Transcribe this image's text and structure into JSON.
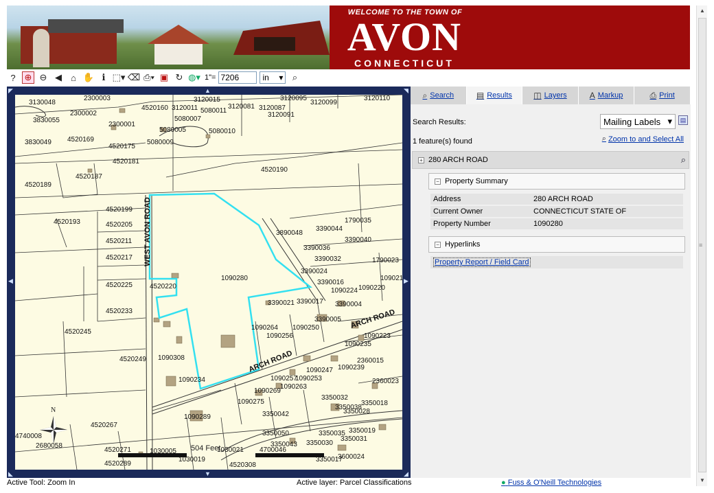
{
  "banner": {
    "welcome": "WELCOME TO THE TOWN OF",
    "town": "AVON",
    "state": "CONNECTICUT"
  },
  "toolbar": {
    "tools": [
      {
        "name": "help-icon",
        "glyph": "?"
      },
      {
        "name": "zoom-in-icon",
        "glyph": "⊕"
      },
      {
        "name": "zoom-out-icon",
        "glyph": "⊖"
      },
      {
        "name": "back-icon",
        "glyph": "◀"
      },
      {
        "name": "full-extent-icon",
        "glyph": "⌂"
      },
      {
        "name": "pan-hand-icon",
        "glyph": "✋"
      },
      {
        "name": "identify-icon",
        "glyph": "ℹ"
      },
      {
        "name": "select-icon",
        "glyph": "⬚"
      },
      {
        "name": "clear-selection-icon",
        "glyph": "⌫"
      },
      {
        "name": "print-icon",
        "glyph": "⎙"
      },
      {
        "name": "layer-icon",
        "glyph": "▣"
      },
      {
        "name": "refresh-icon",
        "glyph": "↻"
      },
      {
        "name": "globe-icon",
        "glyph": "◍"
      }
    ],
    "scale_prefix": "1\"=",
    "scale_value": "7206",
    "unit": "in",
    "find_icon": "magnifier-icon"
  },
  "tabs": [
    {
      "label": "Search",
      "icon": "search-icon",
      "glyph": "⌕"
    },
    {
      "label": "Results",
      "icon": "results-icon",
      "glyph": "▤"
    },
    {
      "label": "Layers",
      "icon": "layers-icon",
      "glyph": "◫"
    },
    {
      "label": "Markup",
      "icon": "markup-icon",
      "glyph": "A"
    },
    {
      "label": "Print",
      "icon": "printer-icon",
      "glyph": "⎙"
    }
  ],
  "results": {
    "search_results_label": "Search Results:",
    "mailing_option": "Mailing Labels",
    "found_text": "1 feature(s) found",
    "zoom_select_all": "Zoom to and Select All",
    "feature_title": "280 ARCH ROAD",
    "summary_title": "Property Summary",
    "summary": [
      {
        "key": "Address",
        "value": "280 ARCH ROAD"
      },
      {
        "key": "Current Owner",
        "value": "CONNECTICUT STATE OF"
      },
      {
        "key": "Property Number",
        "value": "1090280"
      }
    ],
    "hyperlinks_title": "Hyperlinks",
    "report_link": "Property Report / Field Card"
  },
  "map": {
    "north_label": "N",
    "scale_text": "504 Feet",
    "highlight_color": "#33e0f0",
    "road_labels": [
      "WEST AVON ROAD",
      "ARCH ROAD",
      "ARCH ROAD"
    ],
    "parcels": [
      "3130048",
      "2300003",
      "4520160",
      "3120011",
      "3120015",
      "3120081",
      "3120087",
      "3120095",
      "3120099",
      "3120110",
      "3830055",
      "2300002",
      "5080007",
      "5080011",
      "3120091",
      "2300001",
      "5080005",
      "5080010",
      "3830049",
      "4520169",
      "4520175",
      "5080009",
      "4520181",
      "4520190",
      "4520189",
      "4520187",
      "4520199",
      "4520193",
      "4520205",
      "4520211",
      "4520217",
      "4520225",
      "4520233",
      "4520245",
      "4520249",
      "4520220",
      "1090280",
      "3390044",
      "3390036",
      "3390040",
      "3390032",
      "3390024",
      "1790023",
      "1790035",
      "3390016",
      "1090224",
      "1090220",
      "1090214",
      "3390021",
      "3390017",
      "3390004",
      "1090264",
      "1090250",
      "3390005",
      "1090256",
      "1090223",
      "1090235",
      "1090308",
      "1090234",
      "1090257",
      "1090253",
      "1090247",
      "1090239",
      "2360015",
      "2360023",
      "1090269",
      "1090263",
      "1090275",
      "3350032",
      "3350038",
      "3350018",
      "1090289",
      "3350042",
      "3350028",
      "4520267",
      "3350050",
      "3350035",
      "3350031",
      "3350019",
      "4740008",
      "2680058",
      "4520271",
      "1030005",
      "1030019",
      "1030021",
      "4700046",
      "3350043",
      "3350030",
      "4520289",
      "4520308",
      "3350017",
      "3600024",
      "3890048"
    ]
  },
  "status": {
    "active_tool": "Active Tool: Zoom In",
    "active_layer": "Active layer: Parcel Classifications",
    "credit": "Fuss & O'Neill Technologies"
  }
}
